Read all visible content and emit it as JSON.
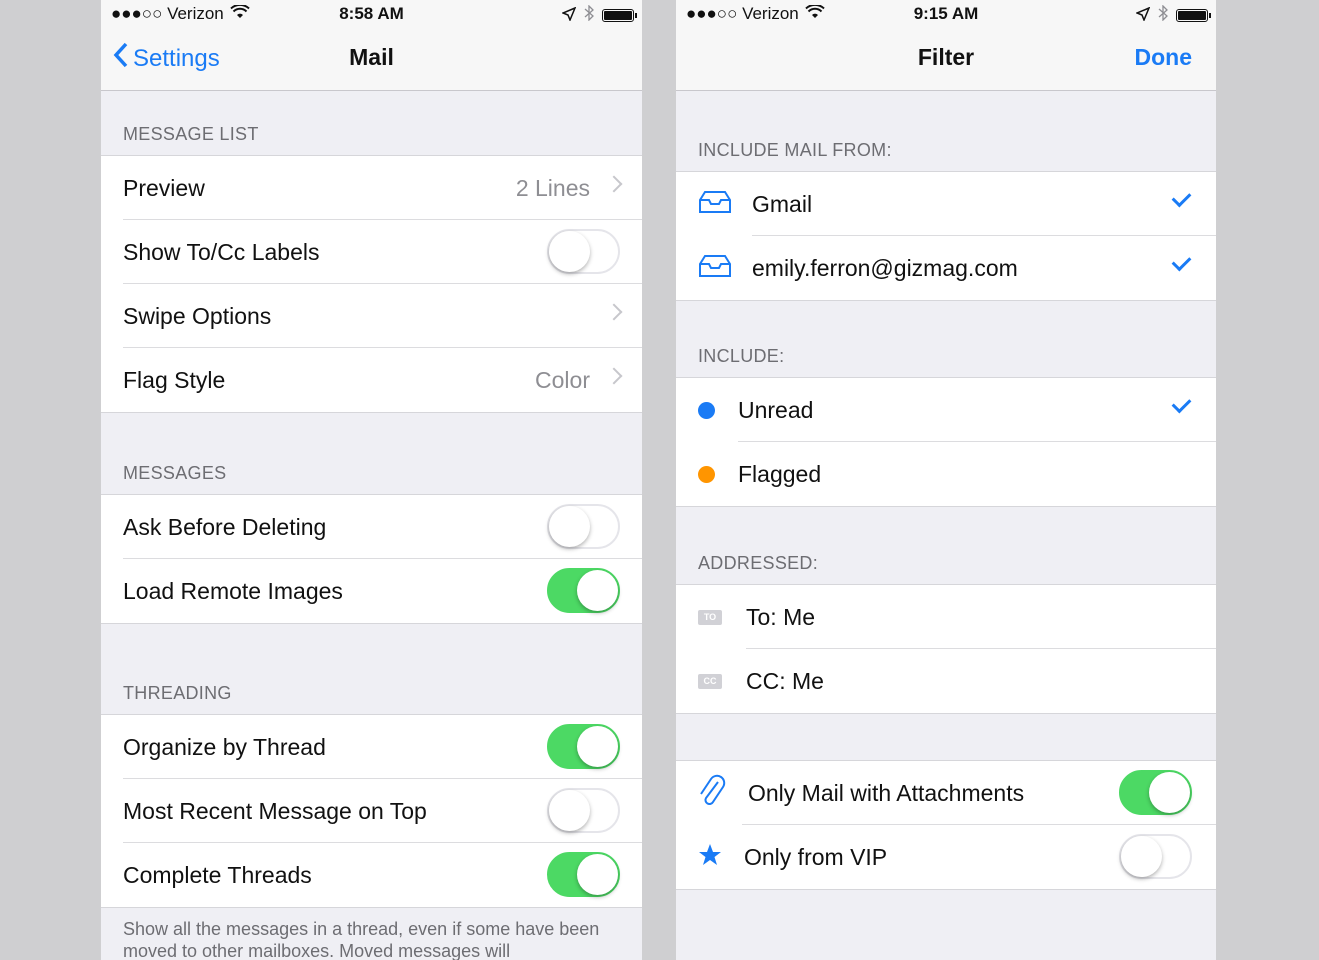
{
  "left": {
    "status": {
      "carrier": "●●●○○ Verizon",
      "time": "8:58 AM"
    },
    "nav": {
      "back_label": "Settings",
      "title": "Mail"
    },
    "message_list": {
      "header": "MESSAGE LIST",
      "rows": [
        {
          "label": "Preview",
          "value": "2 Lines"
        },
        {
          "label": "Show To/Cc Labels",
          "toggle": false
        },
        {
          "label": "Swipe Options"
        },
        {
          "label": "Flag Style",
          "value": "Color"
        }
      ]
    },
    "messages": {
      "header": "MESSAGES",
      "rows": [
        {
          "label": "Ask Before Deleting",
          "toggle": false
        },
        {
          "label": "Load Remote Images",
          "toggle": true
        }
      ]
    },
    "threading": {
      "header": "THREADING",
      "rows": [
        {
          "label": "Organize by Thread",
          "toggle": true
        },
        {
          "label": "Most Recent Message on Top",
          "toggle": false
        },
        {
          "label": "Complete Threads",
          "toggle": true
        }
      ],
      "footer": "Show all the messages in a thread, even if some have been moved to other mailboxes. Moved messages will"
    }
  },
  "right": {
    "status": {
      "carrier": "●●●○○ Verizon",
      "time": "9:15 AM"
    },
    "nav": {
      "title": "Filter",
      "done_label": "Done"
    },
    "include_mail_from": {
      "header": "INCLUDE MAIL FROM:",
      "rows": [
        {
          "label": "Gmail",
          "checked": true,
          "icon": "inbox-icon"
        },
        {
          "label": "emily.ferron@gizmag.com",
          "checked": true,
          "icon": "inbox-icon"
        }
      ]
    },
    "include": {
      "header": "INCLUDE:",
      "rows": [
        {
          "label": "Unread",
          "checked": true,
          "dot_color": "#1a7bf5"
        },
        {
          "label": "Flagged",
          "checked": false,
          "dot_color": "#ff9500"
        }
      ]
    },
    "addressed": {
      "header": "ADDRESSED:",
      "rows": [
        {
          "label": "To: Me",
          "tag": "TO"
        },
        {
          "label": "CC: Me",
          "tag": "CC"
        }
      ]
    },
    "other": {
      "rows": [
        {
          "label": "Only Mail with Attachments",
          "toggle": true,
          "icon": "paperclip-icon"
        },
        {
          "label": "Only from VIP",
          "toggle": false,
          "icon": "star-icon"
        }
      ]
    }
  }
}
